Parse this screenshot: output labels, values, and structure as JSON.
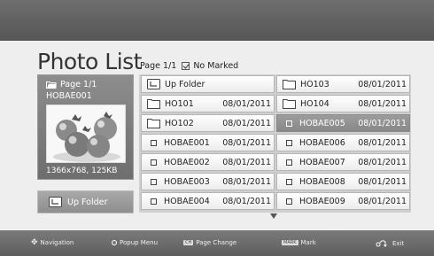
{
  "header": {
    "title": "Photo List"
  },
  "subheader": {
    "page": "Page 1/1",
    "marked": "No Marked"
  },
  "preview": {
    "page": "Page 1/1",
    "filename": "HOBAE001",
    "resolution": "1366x768, 125KB"
  },
  "sidebar": {
    "up_folder_label": "Up Folder"
  },
  "grid": {
    "left": [
      {
        "type": "up",
        "name": "Up Folder",
        "date": ""
      },
      {
        "type": "folder",
        "name": "HO101",
        "date": "08/01/2011"
      },
      {
        "type": "folder",
        "name": "HO102",
        "date": "08/01/2011"
      },
      {
        "type": "file",
        "name": "HOBAE001",
        "date": "08/01/2011"
      },
      {
        "type": "file",
        "name": "HOBAE002",
        "date": "08/01/2011"
      },
      {
        "type": "file",
        "name": "HOBAE003",
        "date": "08/01/2011"
      },
      {
        "type": "file",
        "name": "HOBAE004",
        "date": "08/01/2011"
      }
    ],
    "right": [
      {
        "type": "folder",
        "name": "HO103",
        "date": "08/01/2011"
      },
      {
        "type": "folder",
        "name": "HO104",
        "date": "08/01/2011"
      },
      {
        "type": "file",
        "name": "HOBAE005",
        "date": "08/01/2011",
        "selected": true
      },
      {
        "type": "file",
        "name": "HOBAE006",
        "date": "08/01/2011"
      },
      {
        "type": "file",
        "name": "HOBAE007",
        "date": "08/01/2011"
      },
      {
        "type": "file",
        "name": "HOBAE008",
        "date": "08/01/2011"
      },
      {
        "type": "file",
        "name": "HOBAE009",
        "date": "08/01/2011"
      }
    ]
  },
  "footer": {
    "navigation": "Navigation",
    "popup_menu": "Popup Menu",
    "page_change_key": "CH",
    "page_change": "Page Change",
    "mark_key": "MARK",
    "mark": "Mark",
    "exit": "Exit"
  }
}
